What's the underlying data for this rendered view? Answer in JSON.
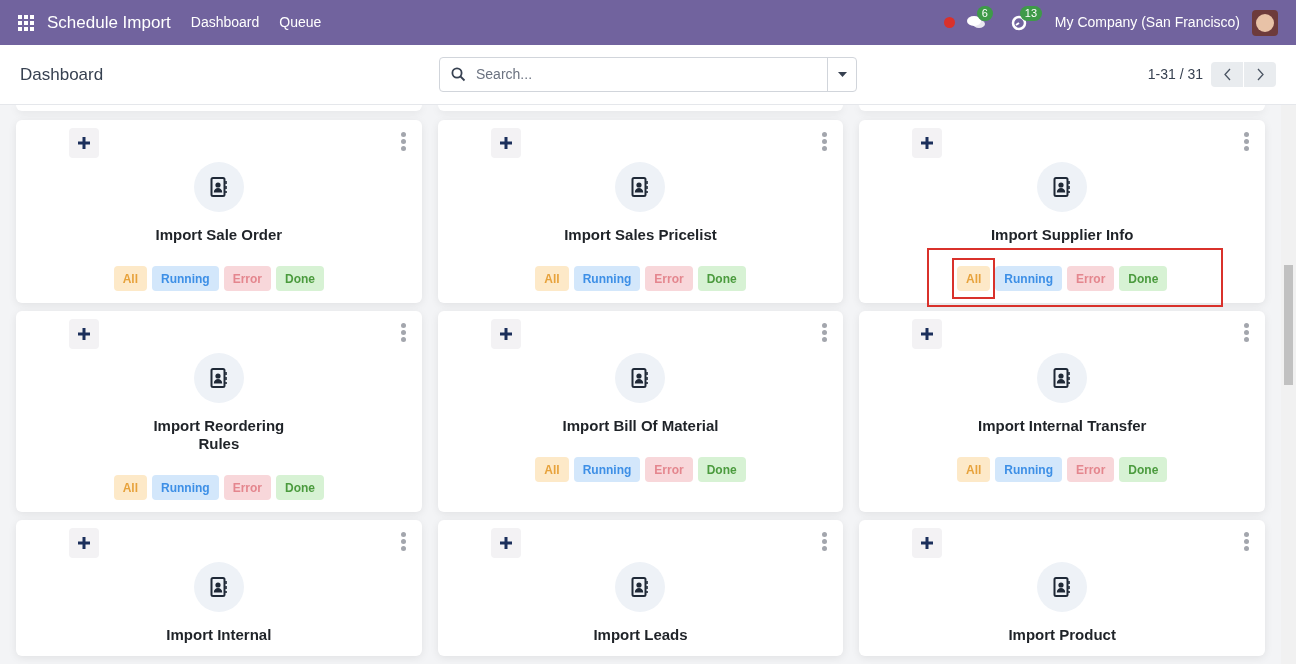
{
  "navbar": {
    "app_title": "Schedule Import",
    "menu": [
      {
        "label": "Dashboard"
      },
      {
        "label": "Queue"
      }
    ],
    "chat_count": "6",
    "activity_count": "13",
    "company": "My Company (San Francisco)"
  },
  "control_panel": {
    "breadcrumb": "Dashboard",
    "search": {
      "placeholder": "Search..."
    },
    "pager": "1-31 / 31"
  },
  "cards": [
    {
      "title": "Import Sale Order",
      "highlight": false,
      "badges": [
        {
          "kind": "all",
          "label": "All"
        },
        {
          "kind": "running",
          "label": "Running"
        },
        {
          "kind": "error",
          "label": "Error"
        },
        {
          "kind": "done",
          "label": "Done"
        }
      ]
    },
    {
      "title": "Import Sales Pricelist",
      "highlight": false,
      "badges": [
        {
          "kind": "all",
          "label": "All"
        },
        {
          "kind": "running",
          "label": "Running"
        },
        {
          "kind": "error",
          "label": "Error"
        },
        {
          "kind": "done",
          "label": "Done"
        }
      ]
    },
    {
      "title": "Import Supplier Info",
      "highlight": true,
      "badges": [
        {
          "kind": "all",
          "label": "All"
        },
        {
          "kind": "running",
          "label": "Running"
        },
        {
          "kind": "error",
          "label": "Error"
        },
        {
          "kind": "done",
          "label": "Done"
        }
      ]
    },
    {
      "title": "Import Reordering Rules",
      "highlight": false,
      "badges": [
        {
          "kind": "all",
          "label": "All"
        },
        {
          "kind": "running",
          "label": "Running"
        },
        {
          "kind": "error",
          "label": "Error"
        },
        {
          "kind": "done",
          "label": "Done"
        }
      ]
    },
    {
      "title": "Import Bill Of Material",
      "highlight": false,
      "badges": [
        {
          "kind": "all",
          "label": "All"
        },
        {
          "kind": "running",
          "label": "Running"
        },
        {
          "kind": "error",
          "label": "Error"
        },
        {
          "kind": "done",
          "label": "Done"
        }
      ]
    },
    {
      "title": "Import Internal Transfer",
      "highlight": false,
      "badges": [
        {
          "kind": "all",
          "label": "All"
        },
        {
          "kind": "running",
          "label": "Running"
        },
        {
          "kind": "error",
          "label": "Error"
        },
        {
          "kind": "done",
          "label": "Done"
        }
      ]
    },
    {
      "title": "Import Internal",
      "highlight": false
    },
    {
      "title": "Import Leads",
      "highlight": false
    },
    {
      "title": "Import Product",
      "highlight": false
    }
  ]
}
